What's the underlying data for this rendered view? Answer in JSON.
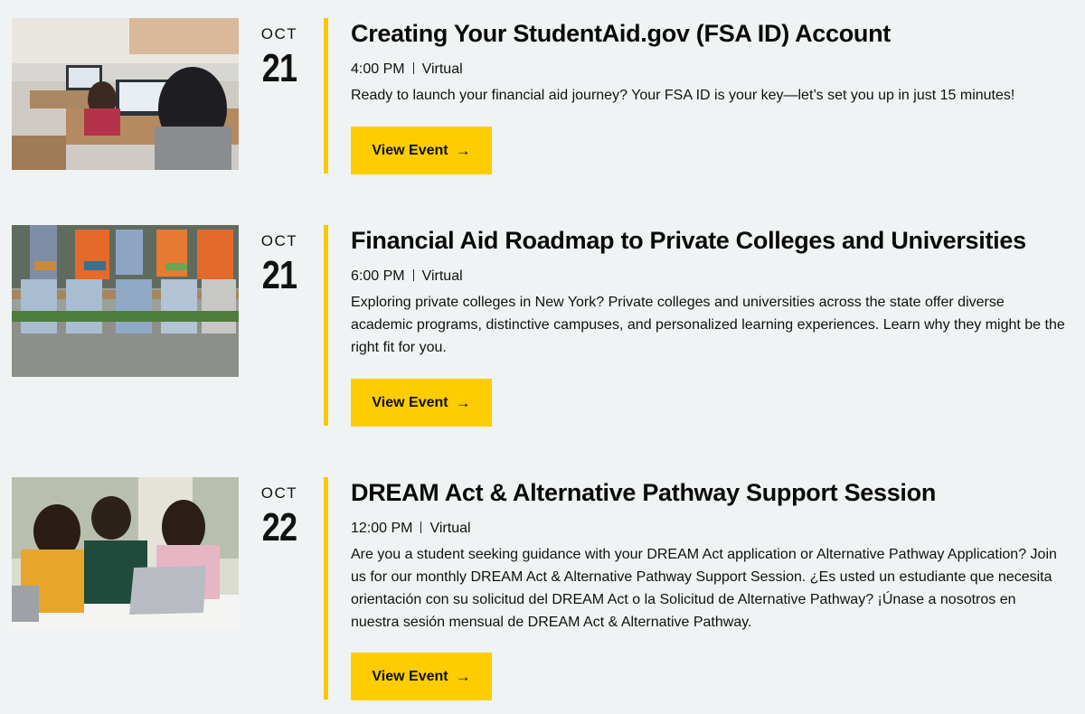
{
  "events": [
    {
      "month": "OCT",
      "day": "21",
      "title": "Creating Your StudentAid.gov (FSA ID) Account",
      "time": "4:00 PM",
      "location": "Virtual",
      "description": "Ready to launch your financial aid journey? Your FSA ID is your key—let’s set you up in just 15 minutes!",
      "button_label": "View Event",
      "image_icon": "computer-lab-photo"
    },
    {
      "month": "OCT",
      "day": "21",
      "title": "Financial Aid Roadmap to Private Colleges and Universities",
      "time": "6:00 PM",
      "location": "Virtual",
      "description": "Exploring private colleges in New York? Private colleges and universities across the state offer diverse academic programs, distinctive campuses, and personalized learning experiences. Learn why they might be the right fit for you.",
      "button_label": "View Event",
      "image_icon": "students-on-bench-photo"
    },
    {
      "month": "OCT",
      "day": "22",
      "title": "DREAM Act & Alternative Pathway Support Session",
      "time": "12:00 PM",
      "location": "Virtual",
      "description": "Are you a student seeking guidance with your DREAM Act application or Alternative Pathway Application? Join us for our monthly DREAM Act & Alternative Pathway Support Session. ¿Es usted un estudiante que necesita orientación con su solicitud del DREAM Act o la Solicitud de Alternative Pathway? ¡Únase a nosotros en nuestra sesión mensual de DREAM Act & Alternative Pathway.",
      "button_label": "View Event",
      "image_icon": "students-with-laptop-photo"
    }
  ],
  "colors": {
    "accent": "#fdcd01",
    "rule": "#f8c800",
    "background": "#f0f3f4"
  }
}
